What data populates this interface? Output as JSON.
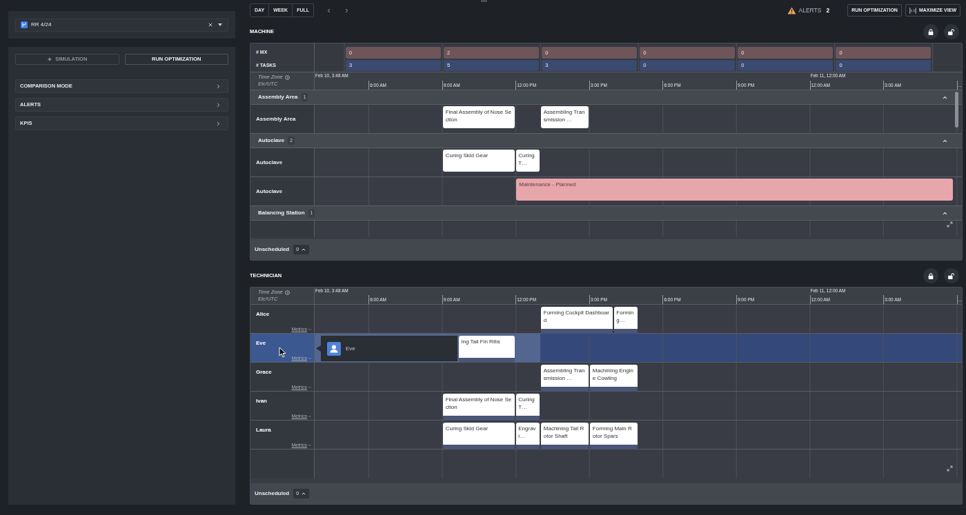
{
  "sidebar": {
    "schedule": {
      "value": "RR 4/24"
    },
    "buttons": [
      {
        "label": "SIMULATION",
        "kind": "add",
        "disabled": true
      },
      {
        "label": "RUN OPTIMIZATION",
        "kind": "plain",
        "disabled": false
      }
    ],
    "sections": [
      {
        "label": "COMPARISON MODE",
        "expanded": false
      },
      {
        "label": "ALERTS",
        "expanded": false
      },
      {
        "label": "KPIS",
        "expanded": false
      }
    ]
  },
  "toolbar": {
    "view_modes": [
      {
        "label": "DAY",
        "selected": false
      },
      {
        "label": "WEEK",
        "selected": false
      },
      {
        "label": "FULL",
        "selected": false
      }
    ],
    "alerts": {
      "label": "ALERTS",
      "count": "2"
    },
    "actions": [
      {
        "label": "RUN OPTIMIZATION",
        "kind": "plain"
      },
      {
        "label": "MAXIMIZE VIEW",
        "kind": "maximize"
      }
    ]
  },
  "panels": [
    {
      "kind": "machine",
      "title": "MACHINE",
      "summary": [
        {
          "label": "# MX",
          "kind": "mx",
          "values": [
            "0",
            "2",
            "0",
            "0",
            "0",
            "0"
          ]
        },
        {
          "label": "# TASKS",
          "kind": "tasks",
          "values": [
            "3",
            "5",
            "3",
            "0",
            "0",
            "0"
          ]
        }
      ],
      "axis": {
        "time_zone_label": "Time Zone",
        "time_zone": "Etc/UTC",
        "start": "Feb 10, 3:48 AM",
        "ticks": [
          {
            "label": "6:00 AM"
          },
          {
            "label": "9:00 AM"
          },
          {
            "label": "12:00 PM"
          },
          {
            "label": "3:00 PM"
          },
          {
            "label": "6:00 PM"
          },
          {
            "label": "9:00 PM"
          },
          {
            "label": "12:00 AM",
            "date": "Feb 11, 12:00 AM"
          },
          {
            "label": "3:00 AM"
          },
          {
            "label": "..."
          }
        ]
      },
      "groups": [
        {
          "name": "Assembly Area",
          "count": "1",
          "expanded": true,
          "rows": [
            {
              "label": "Assembly Area",
              "tasks": [
                {
                  "kind": "task",
                  "title": "Final Assembly of Nose Section"
                },
                {
                  "kind": "task",
                  "title": "Assembling Transmission …"
                }
              ]
            }
          ]
        },
        {
          "name": "Autoclave",
          "count": "2",
          "expanded": true,
          "rows": [
            {
              "label": "Autoclave",
              "tasks": [
                {
                  "kind": "task",
                  "title": "Curing Skid Gear"
                },
                {
                  "kind": "task",
                  "title": "Curing T…"
                }
              ]
            },
            {
              "label": "Autoclave",
              "tasks": [
                {
                  "kind": "maintenance",
                  "title": "Maintenance - Planned"
                }
              ]
            }
          ]
        },
        {
          "name": "Balancing Station",
          "count": "1",
          "expanded": true
        }
      ],
      "unscheduled": {
        "label": "Unscheduled",
        "count": "0"
      }
    },
    {
      "kind": "technician",
      "title": "TECHNICIAN",
      "axis": {
        "time_zone_label": "Time Zone",
        "time_zone": "Etc/UTC",
        "start": "Feb 10, 3:48 AM",
        "ticks": [
          {
            "label": "6:00 AM"
          },
          {
            "label": "9:00 AM"
          },
          {
            "label": "12:00 PM"
          },
          {
            "label": "3:00 PM"
          },
          {
            "label": "6:00 PM"
          },
          {
            "label": "9:00 PM"
          },
          {
            "label": "12:00 AM",
            "date": "Feb 11, 12:00 AM"
          },
          {
            "label": "3:00 AM"
          },
          {
            "label": "..."
          }
        ]
      },
      "rows": [
        {
          "name": "Alice",
          "selected": false,
          "metrics_label": "Metrics",
          "tasks": [
            {
              "kind": "task",
              "title": "Forming Cockpit Dashboard"
            },
            {
              "kind": "task",
              "title": "Forming…"
            }
          ]
        },
        {
          "name": "Eve",
          "selected": true,
          "metrics_label": "Metrics",
          "tasks": [
            {
              "kind": "task",
              "title": "ing Tail Fin Ribs"
            }
          ],
          "hover_card": {
            "name": "Eve"
          }
        },
        {
          "name": "Grace",
          "selected": false,
          "metrics_label": "Metrics",
          "tasks": [
            {
              "kind": "task",
              "title": "Assembling Transmission …"
            },
            {
              "kind": "task",
              "title": "Machining Engine Cowling"
            }
          ]
        },
        {
          "name": "Ivan",
          "selected": false,
          "metrics_label": "Metrics",
          "tasks": [
            {
              "kind": "task",
              "title": "Final Assembly of Nose Section"
            },
            {
              "kind": "task",
              "title": "Curing T…"
            }
          ]
        },
        {
          "name": "Laura",
          "selected": false,
          "metrics_label": "Metrics",
          "tasks": [
            {
              "kind": "task",
              "title": "Curing Skid Gear"
            },
            {
              "kind": "task",
              "title": "Engravi…"
            },
            {
              "kind": "task",
              "title": "Machining Tail Rotor Shaft"
            },
            {
              "kind": "task",
              "title": "Forming Main Rotor Spars"
            }
          ]
        }
      ],
      "unscheduled": {
        "label": "Unscheduled",
        "count": "0"
      }
    }
  ]
}
